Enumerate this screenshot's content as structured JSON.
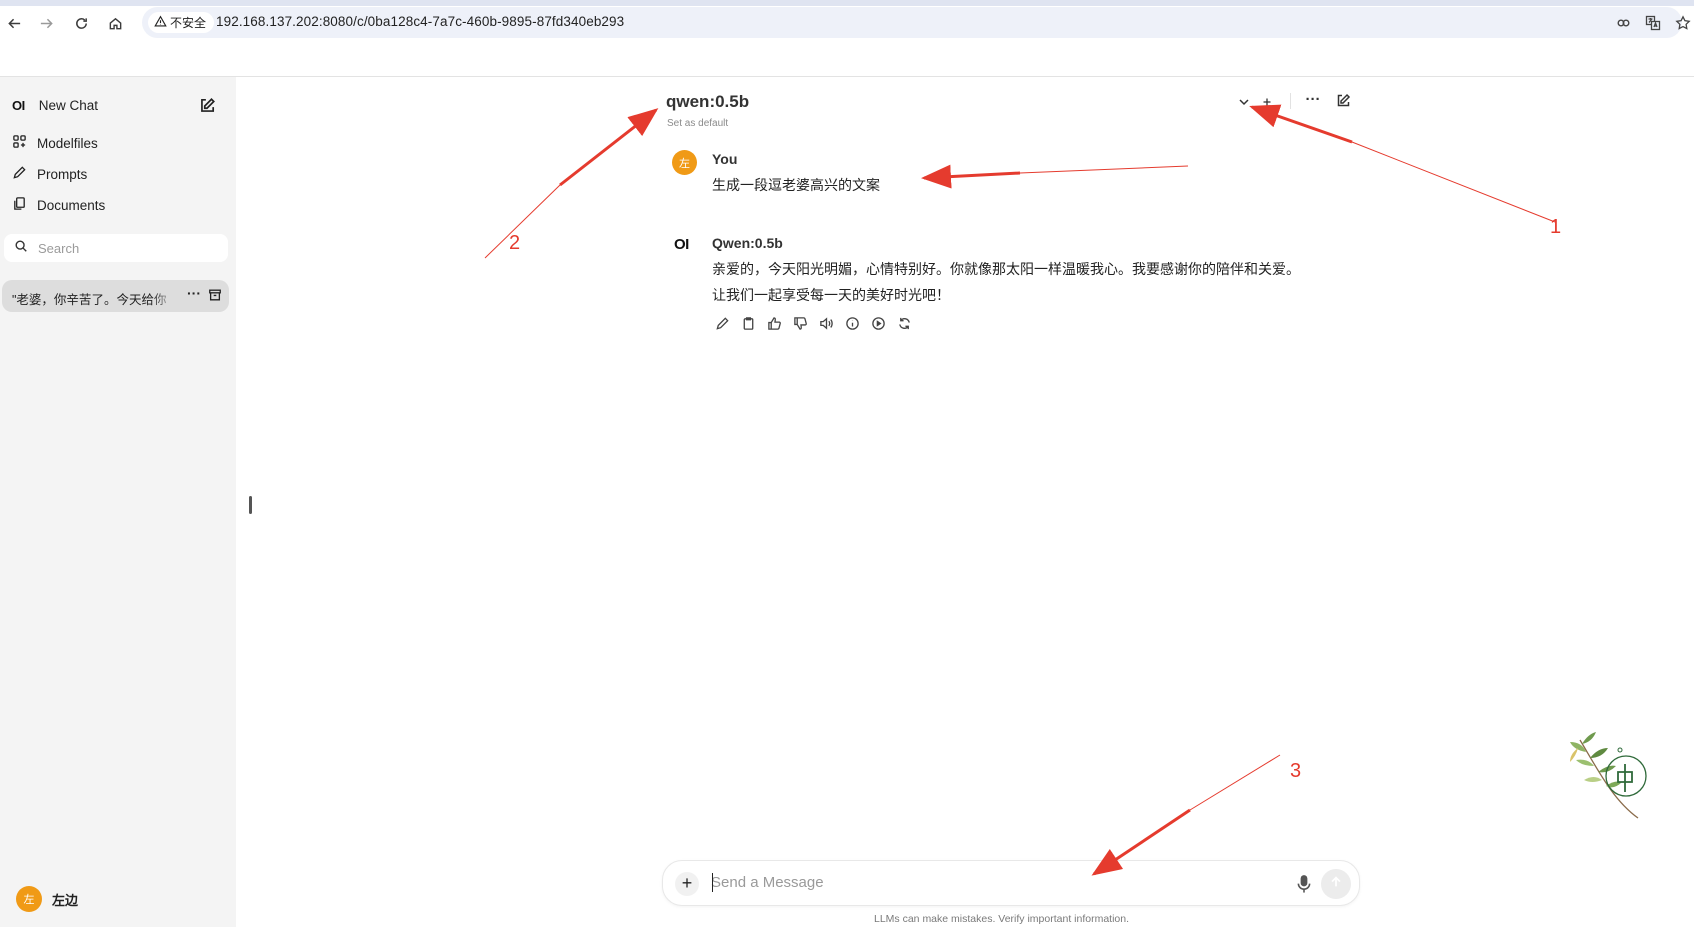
{
  "browser": {
    "security_label": "不安全",
    "url": "192.168.137.202:8080/c/0ba128c4-7a7c-460b-9895-87fd340eb293",
    "icons": [
      "back-icon",
      "forward-icon",
      "reload-icon",
      "home-icon",
      "warning-icon",
      "password-key-icon",
      "translate-icon",
      "bookmark-star-icon"
    ]
  },
  "sidebar": {
    "logo": "OI",
    "new_chat_label": "New Chat",
    "items": [
      {
        "label": "Modelfiles",
        "icon": "modelfiles-icon"
      },
      {
        "label": "Prompts",
        "icon": "pencil-icon"
      },
      {
        "label": "Documents",
        "icon": "documents-icon"
      }
    ],
    "search_placeholder": "Search",
    "chats": [
      {
        "title": "\"老婆，你辛苦了。今天给你",
        "more": "···"
      }
    ],
    "user": {
      "avatar_text": "左",
      "name": "左边"
    }
  },
  "header": {
    "model": "qwen:0.5b",
    "set_default": "Set as default",
    "more": "···"
  },
  "messages": [
    {
      "role": "user",
      "name": "You",
      "avatar_text": "左",
      "text": "生成一段逗老婆高兴的文案"
    },
    {
      "role": "assistant",
      "name": "Qwen:0.5b",
      "avatar_text": "OI",
      "lines": [
        "亲爱的，今天阳光明媚，心情特别好。你就像那太阳一样温暖我心。我要感谢你的陪伴和关爱。",
        "让我们一起享受每一天的美好时光吧！"
      ]
    }
  ],
  "message_actions": [
    "edit-icon",
    "copy-icon",
    "thumbs-up-icon",
    "thumbs-down-icon",
    "read-aloud-icon",
    "info-icon",
    "continue-icon",
    "regenerate-icon"
  ],
  "composer": {
    "plus": "+",
    "placeholder": "Send a Message",
    "disclaimer": "LLMs can make mistakes. Verify important information."
  },
  "annotations": {
    "labels": [
      "1",
      "2",
      "3"
    ],
    "color": "#e53b2e"
  },
  "colors": {
    "user_avatar": "#f09a16",
    "sidebar_bg": "#f4f4f4",
    "active_chat_bg": "#dddddd"
  }
}
